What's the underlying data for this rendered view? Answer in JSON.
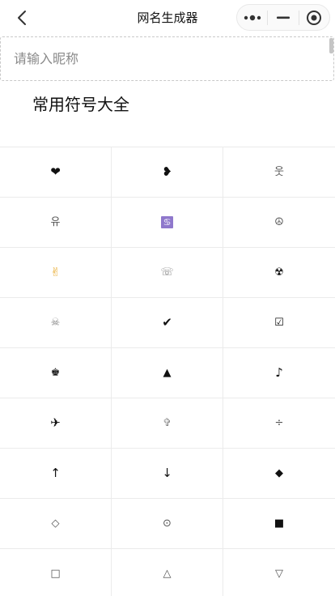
{
  "nav": {
    "title": "网名生成器",
    "back_icon": "chevron-left-icon",
    "capsule": [
      "more-dots-icon",
      "minimize-icon",
      "close-target-icon"
    ]
  },
  "input": {
    "placeholder": "请输入昵称",
    "value": ""
  },
  "section_title": "常用符号大全",
  "symbols": [
    "❤",
    "❥",
    "웃",
    "유",
    "♋",
    "☮",
    "✌",
    "☏",
    "☢",
    "☠",
    "✔",
    "☑",
    "♚",
    "▲",
    "♪",
    "✈",
    "✞",
    "÷",
    "↑",
    "↓",
    "◆",
    "◇",
    "⊙",
    "■",
    "□",
    "△",
    "▽"
  ],
  "colors": {
    "accent_cancer_bg": "#8f78cc",
    "hand": "#e8a92b",
    "grid_line": "#ebebeb"
  }
}
